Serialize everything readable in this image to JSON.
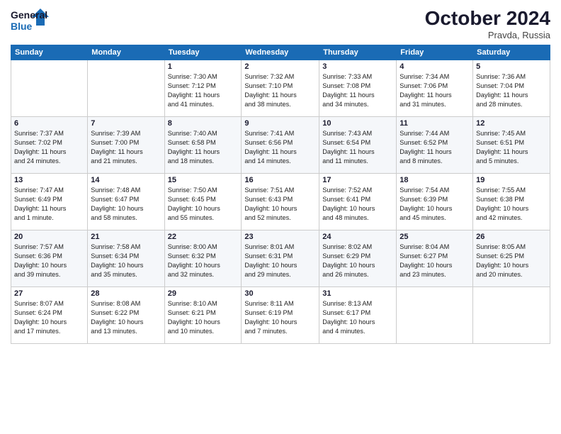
{
  "header": {
    "logo_line1": "General",
    "logo_line2": "Blue",
    "month_title": "October 2024",
    "location": "Pravda, Russia"
  },
  "weekdays": [
    "Sunday",
    "Monday",
    "Tuesday",
    "Wednesday",
    "Thursday",
    "Friday",
    "Saturday"
  ],
  "weeks": [
    [
      {
        "day": "",
        "info": ""
      },
      {
        "day": "",
        "info": ""
      },
      {
        "day": "1",
        "info": "Sunrise: 7:30 AM\nSunset: 7:12 PM\nDaylight: 11 hours\nand 41 minutes."
      },
      {
        "day": "2",
        "info": "Sunrise: 7:32 AM\nSunset: 7:10 PM\nDaylight: 11 hours\nand 38 minutes."
      },
      {
        "day": "3",
        "info": "Sunrise: 7:33 AM\nSunset: 7:08 PM\nDaylight: 11 hours\nand 34 minutes."
      },
      {
        "day": "4",
        "info": "Sunrise: 7:34 AM\nSunset: 7:06 PM\nDaylight: 11 hours\nand 31 minutes."
      },
      {
        "day": "5",
        "info": "Sunrise: 7:36 AM\nSunset: 7:04 PM\nDaylight: 11 hours\nand 28 minutes."
      }
    ],
    [
      {
        "day": "6",
        "info": "Sunrise: 7:37 AM\nSunset: 7:02 PM\nDaylight: 11 hours\nand 24 minutes."
      },
      {
        "day": "7",
        "info": "Sunrise: 7:39 AM\nSunset: 7:00 PM\nDaylight: 11 hours\nand 21 minutes."
      },
      {
        "day": "8",
        "info": "Sunrise: 7:40 AM\nSunset: 6:58 PM\nDaylight: 11 hours\nand 18 minutes."
      },
      {
        "day": "9",
        "info": "Sunrise: 7:41 AM\nSunset: 6:56 PM\nDaylight: 11 hours\nand 14 minutes."
      },
      {
        "day": "10",
        "info": "Sunrise: 7:43 AM\nSunset: 6:54 PM\nDaylight: 11 hours\nand 11 minutes."
      },
      {
        "day": "11",
        "info": "Sunrise: 7:44 AM\nSunset: 6:52 PM\nDaylight: 11 hours\nand 8 minutes."
      },
      {
        "day": "12",
        "info": "Sunrise: 7:45 AM\nSunset: 6:51 PM\nDaylight: 11 hours\nand 5 minutes."
      }
    ],
    [
      {
        "day": "13",
        "info": "Sunrise: 7:47 AM\nSunset: 6:49 PM\nDaylight: 11 hours\nand 1 minute."
      },
      {
        "day": "14",
        "info": "Sunrise: 7:48 AM\nSunset: 6:47 PM\nDaylight: 10 hours\nand 58 minutes."
      },
      {
        "day": "15",
        "info": "Sunrise: 7:50 AM\nSunset: 6:45 PM\nDaylight: 10 hours\nand 55 minutes."
      },
      {
        "day": "16",
        "info": "Sunrise: 7:51 AM\nSunset: 6:43 PM\nDaylight: 10 hours\nand 52 minutes."
      },
      {
        "day": "17",
        "info": "Sunrise: 7:52 AM\nSunset: 6:41 PM\nDaylight: 10 hours\nand 48 minutes."
      },
      {
        "day": "18",
        "info": "Sunrise: 7:54 AM\nSunset: 6:39 PM\nDaylight: 10 hours\nand 45 minutes."
      },
      {
        "day": "19",
        "info": "Sunrise: 7:55 AM\nSunset: 6:38 PM\nDaylight: 10 hours\nand 42 minutes."
      }
    ],
    [
      {
        "day": "20",
        "info": "Sunrise: 7:57 AM\nSunset: 6:36 PM\nDaylight: 10 hours\nand 39 minutes."
      },
      {
        "day": "21",
        "info": "Sunrise: 7:58 AM\nSunset: 6:34 PM\nDaylight: 10 hours\nand 35 minutes."
      },
      {
        "day": "22",
        "info": "Sunrise: 8:00 AM\nSunset: 6:32 PM\nDaylight: 10 hours\nand 32 minutes."
      },
      {
        "day": "23",
        "info": "Sunrise: 8:01 AM\nSunset: 6:31 PM\nDaylight: 10 hours\nand 29 minutes."
      },
      {
        "day": "24",
        "info": "Sunrise: 8:02 AM\nSunset: 6:29 PM\nDaylight: 10 hours\nand 26 minutes."
      },
      {
        "day": "25",
        "info": "Sunrise: 8:04 AM\nSunset: 6:27 PM\nDaylight: 10 hours\nand 23 minutes."
      },
      {
        "day": "26",
        "info": "Sunrise: 8:05 AM\nSunset: 6:25 PM\nDaylight: 10 hours\nand 20 minutes."
      }
    ],
    [
      {
        "day": "27",
        "info": "Sunrise: 8:07 AM\nSunset: 6:24 PM\nDaylight: 10 hours\nand 17 minutes."
      },
      {
        "day": "28",
        "info": "Sunrise: 8:08 AM\nSunset: 6:22 PM\nDaylight: 10 hours\nand 13 minutes."
      },
      {
        "day": "29",
        "info": "Sunrise: 8:10 AM\nSunset: 6:21 PM\nDaylight: 10 hours\nand 10 minutes."
      },
      {
        "day": "30",
        "info": "Sunrise: 8:11 AM\nSunset: 6:19 PM\nDaylight: 10 hours\nand 7 minutes."
      },
      {
        "day": "31",
        "info": "Sunrise: 8:13 AM\nSunset: 6:17 PM\nDaylight: 10 hours\nand 4 minutes."
      },
      {
        "day": "",
        "info": ""
      },
      {
        "day": "",
        "info": ""
      }
    ]
  ]
}
